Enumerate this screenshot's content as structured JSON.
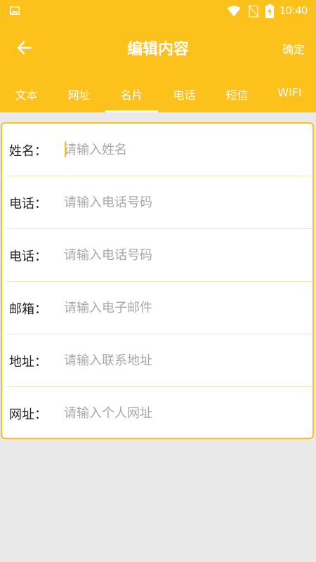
{
  "status_bar": {
    "time": "10:40",
    "icons": [
      "gallery-icon",
      "wifi-icon",
      "no-sim-icon",
      "battery-charging-icon"
    ]
  },
  "toolbar": {
    "title": "编辑内容",
    "confirm_label": "确定",
    "back_icon": "arrow-left-icon"
  },
  "tabs": [
    {
      "label": "文本",
      "active": false
    },
    {
      "label": "网址",
      "active": false
    },
    {
      "label": "名片",
      "active": true
    },
    {
      "label": "电话",
      "active": false
    },
    {
      "label": "短信",
      "active": false
    },
    {
      "label": "WIFI",
      "active": false
    }
  ],
  "form": {
    "fields": [
      {
        "label": "姓名：",
        "value": "",
        "placeholder": "请输入姓名"
      },
      {
        "label": "电话：",
        "value": "",
        "placeholder": "请输入电话号码"
      },
      {
        "label": "电话：",
        "value": "",
        "placeholder": "请输入电话号码"
      },
      {
        "label": "邮箱：",
        "value": "",
        "placeholder": "请输入电子邮件"
      },
      {
        "label": "地址：",
        "value": "",
        "placeholder": "请输入联系地址"
      },
      {
        "label": "网址：",
        "value": "",
        "placeholder": "请输入个人网址"
      }
    ]
  },
  "colors": {
    "accent": "#fcc11a",
    "background": "#e9e9e9"
  }
}
